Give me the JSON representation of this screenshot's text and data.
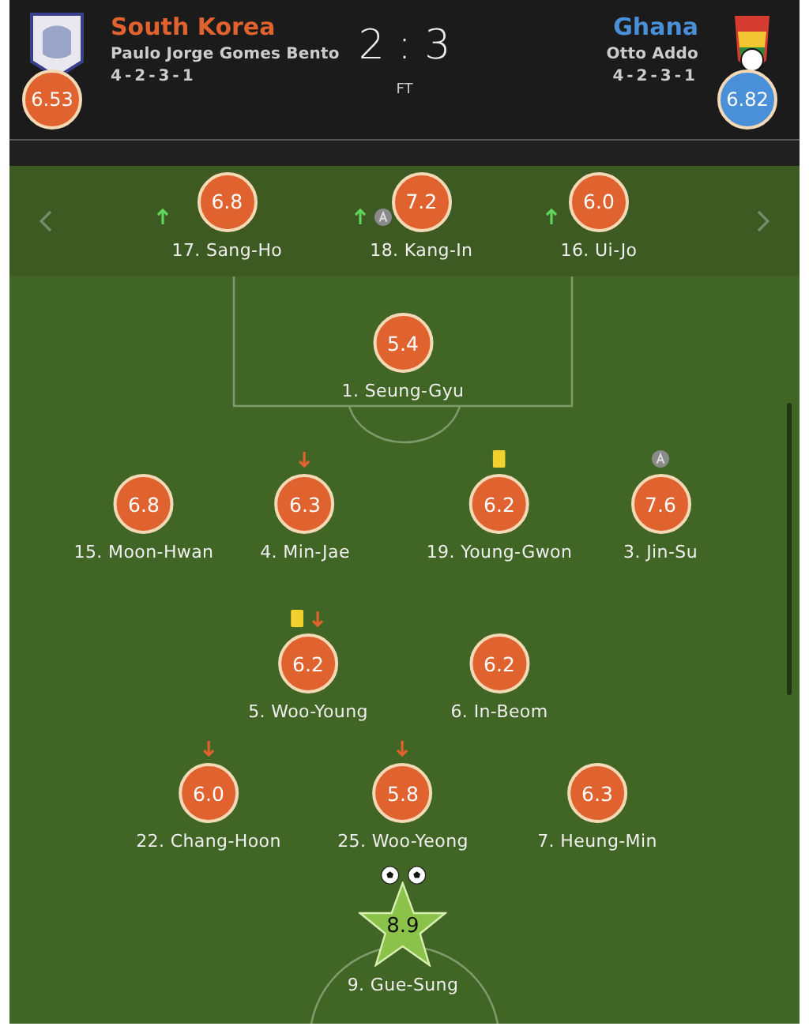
{
  "home": {
    "name": "South Korea",
    "coach": "Paulo Jorge Gomes Bento",
    "formation": "4-2-3-1",
    "rating": "6.53"
  },
  "away": {
    "name": "Ghana",
    "coach": "Otto Addo",
    "formation": "4-2-3-1",
    "rating": "6.82"
  },
  "score": "2 : 3",
  "status": "FT",
  "substitutes": [
    {
      "number_name": "17. Sang-Ho",
      "rating": "6.8",
      "subbed_in": true,
      "captain": false
    },
    {
      "number_name": "18. Kang-In",
      "rating": "7.2",
      "subbed_in": true,
      "captain": true
    },
    {
      "number_name": "16. Ui-Jo",
      "rating": "6.0",
      "subbed_in": true,
      "captain": false
    }
  ],
  "lineup": [
    {
      "players": [
        {
          "number_name": "1. Seung-Gyu",
          "rating": "5.4",
          "best": false,
          "booked": false,
          "subbed_off": false,
          "captain": false
        }
      ]
    },
    {
      "players": [
        {
          "number_name": "15. Moon-Hwan",
          "rating": "6.8",
          "best": false,
          "booked": false,
          "subbed_off": false,
          "captain": false
        },
        {
          "number_name": "4. Min-Jae",
          "rating": "6.3",
          "best": false,
          "booked": false,
          "subbed_off": true,
          "captain": false
        },
        {
          "number_name": "19. Young-Gwon",
          "rating": "6.2",
          "best": false,
          "booked": true,
          "subbed_off": false,
          "captain": false
        },
        {
          "number_name": "3. Jin-Su",
          "rating": "7.6",
          "best": false,
          "booked": false,
          "subbed_off": false,
          "captain": true
        }
      ]
    },
    {
      "players": [
        {
          "number_name": "5. Woo-Young",
          "rating": "6.2",
          "best": false,
          "booked": true,
          "subbed_off": true,
          "captain": false
        },
        {
          "number_name": "6. In-Beom",
          "rating": "6.2",
          "best": false,
          "booked": false,
          "subbed_off": false,
          "captain": false
        }
      ]
    },
    {
      "players": [
        {
          "number_name": "22. Chang-Hoon",
          "rating": "6.0",
          "best": false,
          "booked": false,
          "subbed_off": true,
          "captain": false
        },
        {
          "number_name": "25. Woo-Yeong",
          "rating": "5.8",
          "best": false,
          "booked": false,
          "subbed_off": true,
          "captain": false
        },
        {
          "number_name": "7. Heung-Min",
          "rating": "6.3",
          "best": false,
          "booked": false,
          "subbed_off": false,
          "captain": false
        }
      ]
    },
    {
      "players": [
        {
          "number_name": "9. Gue-Sung",
          "rating": "8.9",
          "best": true,
          "booked": false,
          "subbed_off": false,
          "captain": false,
          "goals": [
            {
              "kind": "goal"
            },
            {
              "kind": "goal"
            }
          ]
        }
      ]
    }
  ]
}
